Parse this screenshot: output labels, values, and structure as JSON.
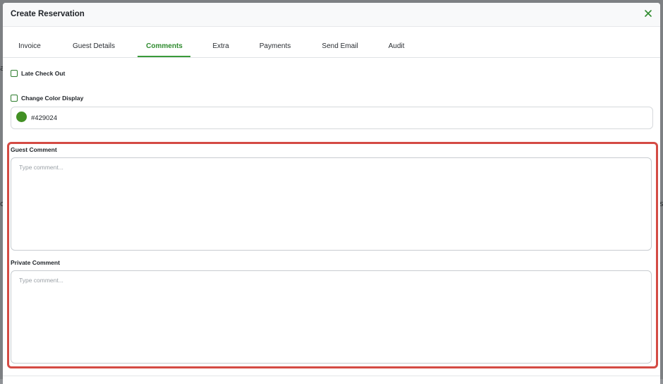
{
  "modal": {
    "title": "Create Reservation",
    "close_icon": "close-icon"
  },
  "tabs": [
    {
      "label": "Invoice",
      "active": false
    },
    {
      "label": "Guest Details",
      "active": false
    },
    {
      "label": "Comments",
      "active": true
    },
    {
      "label": "Extra",
      "active": false
    },
    {
      "label": "Payments",
      "active": false
    },
    {
      "label": "Send Email",
      "active": false
    },
    {
      "label": "Audit",
      "active": false
    }
  ],
  "options": {
    "late_check_out": {
      "label": "Late Check Out",
      "checked": false
    },
    "change_color_display": {
      "label": "Change Color Display",
      "checked": false
    }
  },
  "color_display": {
    "value": "#429024",
    "swatch_color": "#429024"
  },
  "guest_comment": {
    "label": "Guest Comment",
    "placeholder": "Type comment...",
    "value": ""
  },
  "private_comment": {
    "label": "Private Comment",
    "placeholder": "Type comment...",
    "value": ""
  },
  "colors": {
    "accent": "#2e8b2e",
    "highlight": "#d44b44"
  }
}
